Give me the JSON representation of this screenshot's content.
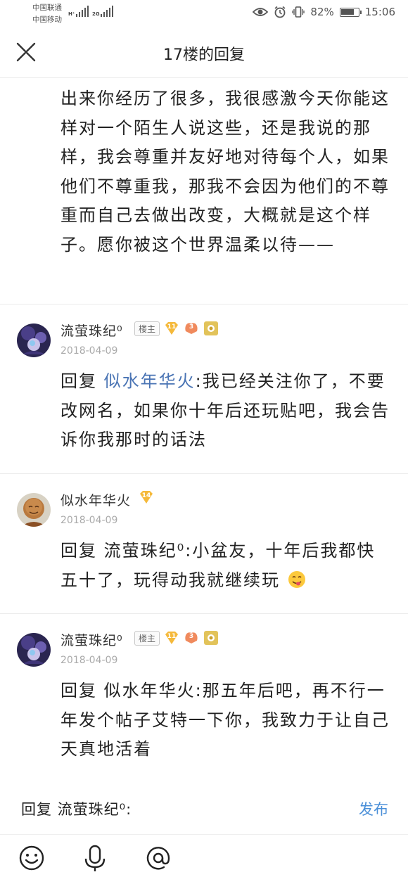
{
  "status_bar": {
    "carrier_1": "中国联通",
    "carrier_2": "中国移动",
    "sim1_type": "H⁺",
    "sim2_type": "2G",
    "battery_percent": "82%",
    "battery_level": 0.82,
    "time": "15:06"
  },
  "nav": {
    "title": "17楼的回复"
  },
  "main_post": {
    "text": "出来你经历了很多，我很感激今天你能这样对一个陌生人说这些，还是我说的那样，我会尊重并友好地对待每个人，如果他们不尊重我，那我不会因为他们的不尊重而自己去做出改变，大概就是这个样子。愿你被这个世界温柔以待——"
  },
  "comments": [
    {
      "username": "流萤珠纪⁰",
      "owner_badge": "楼主",
      "level": "11",
      "badge_3": "3",
      "date": "2018-04-09",
      "reply_prefix": "回复 ",
      "reply_to": "似水年华火",
      "text": ":我已经关注你了，不要改网名，如果你十年后还玩贴吧，我会告诉你我那时的话法"
    },
    {
      "username": "似水年华火",
      "level": "14",
      "date": "2018-04-09",
      "reply_prefix": "回复 ",
      "reply_to": "流萤珠纪⁰",
      "text": ":小盆友，十年后我都快五十了，玩得动我就继续玩"
    },
    {
      "username": "流萤珠纪⁰",
      "owner_badge": "楼主",
      "level": "11",
      "badge_3": "3",
      "date": "2018-04-09",
      "reply_prefix": "回复 ",
      "reply_to": "似水年华火",
      "text": ":那五年后吧，再不行一年发个帖子艾特一下你，我致力于让自己天真地活着"
    }
  ],
  "reply_bar": {
    "input_text": "回复 流萤珠纪⁰:",
    "publish_label": "发布"
  },
  "colors": {
    "link": "#4a74b4",
    "publish": "#4a8fd8",
    "level_badge": "#f5b93a"
  }
}
